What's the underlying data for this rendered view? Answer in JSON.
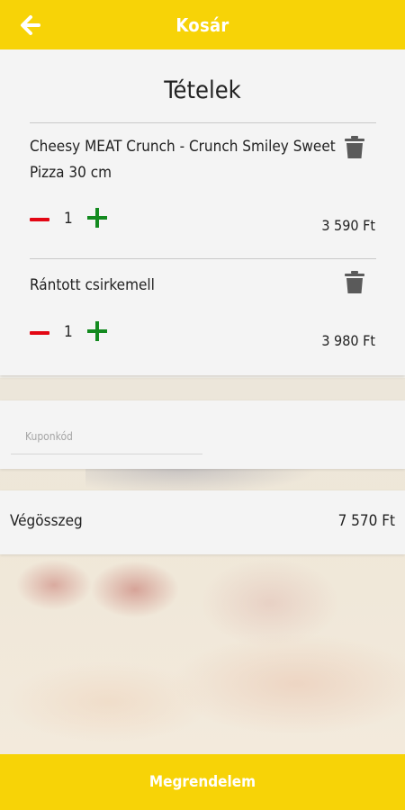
{
  "header": {
    "title": "Kosár",
    "back_icon": "arrow-left-icon"
  },
  "items_section": {
    "title": "Tételek",
    "items": [
      {
        "name": "Cheesy MEAT Crunch - Crunch Smiley Sweet Pizza 30 cm",
        "quantity": "1",
        "price": "3 590 Ft",
        "delete_icon": "trash-icon"
      },
      {
        "name": "Rántott csirkemell",
        "quantity": "1",
        "price": "3 980 Ft",
        "delete_icon": "trash-icon"
      }
    ]
  },
  "coupon": {
    "placeholder": "Kuponkód"
  },
  "summary": {
    "total_label": "Végösszeg",
    "total_value": "7 570 Ft"
  },
  "footer": {
    "order_label": "Megrendelem"
  },
  "colors": {
    "accent": "#f7d307",
    "minus": "#e30613",
    "plus": "#138a1f"
  }
}
